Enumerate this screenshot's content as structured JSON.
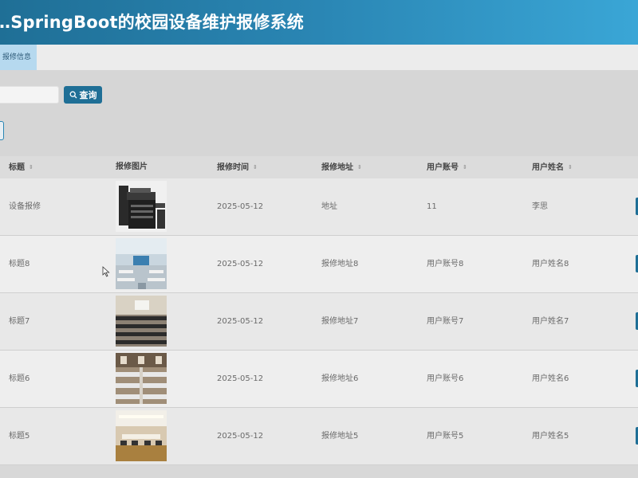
{
  "header": {
    "title": "…SpringBoot的校园设备维护报修系统"
  },
  "tabs": [
    {
      "label": "报修信息"
    }
  ],
  "search": {
    "button_label": "查询",
    "placeholder": ""
  },
  "table": {
    "columns": [
      {
        "label": "标题",
        "sortable": true
      },
      {
        "label": "报修图片",
        "sortable": false
      },
      {
        "label": "报修时间",
        "sortable": true
      },
      {
        "label": "报修地址",
        "sortable": true
      },
      {
        "label": "用户账号",
        "sortable": true
      },
      {
        "label": "用户姓名",
        "sortable": true
      }
    ],
    "rows": [
      {
        "title": "设备报修",
        "image": "printer-photo",
        "time": "2025-05-12",
        "address": "地址",
        "account": "11",
        "name": "李思"
      },
      {
        "title": "标题8",
        "image": "classroom-photo",
        "time": "2025-05-12",
        "address": "报修地址8",
        "account": "用户账号8",
        "name": "用户姓名8"
      },
      {
        "title": "标题7",
        "image": "lecture-hall-photo",
        "time": "2025-05-12",
        "address": "报修地址7",
        "account": "用户账号7",
        "name": "用户姓名7"
      },
      {
        "title": "标题6",
        "image": "computer-lab-photo",
        "time": "2025-05-12",
        "address": "报修地址6",
        "account": "用户账号6",
        "name": "用户姓名6"
      },
      {
        "title": "标题5",
        "image": "meeting-room-photo",
        "time": "2025-05-12",
        "address": "报修地址5",
        "account": "用户账号5",
        "name": "用户姓名5"
      }
    ]
  },
  "colors": {
    "header_start": "#1f6f96",
    "header_end": "#3aa6d6",
    "accent": "#1f6f96",
    "tab_active": "#b6d9ef"
  },
  "icons": {
    "search": "search-icon",
    "sort": "sort-icon"
  }
}
